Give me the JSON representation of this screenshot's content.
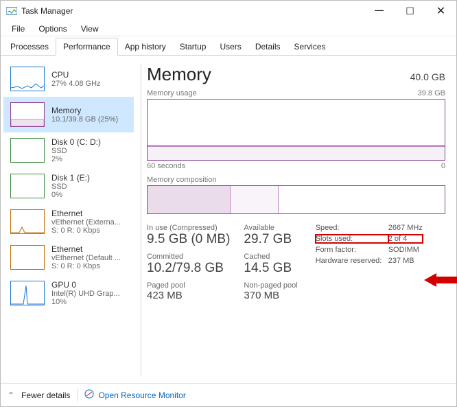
{
  "window": {
    "title": "Task Manager"
  },
  "menu": {
    "file": "File",
    "options": "Options",
    "view": "View"
  },
  "tabs": {
    "processes": "Processes",
    "performance": "Performance",
    "app_history": "App history",
    "startup": "Startup",
    "users": "Users",
    "details": "Details",
    "services": "Services"
  },
  "sidebar": {
    "cpu": {
      "name": "CPU",
      "sub": "27% 4.08 GHz"
    },
    "memory": {
      "name": "Memory",
      "sub": "10.1/39.8 GB (25%)"
    },
    "disk0": {
      "name": "Disk 0 (C: D:)",
      "sub1": "SSD",
      "sub2": "2%"
    },
    "disk1": {
      "name": "Disk 1 (E:)",
      "sub1": "SSD",
      "sub2": "0%"
    },
    "eth0": {
      "name": "Ethernet",
      "sub1": "vEthernet (Externa...",
      "sub2": "S: 0  R: 0 Kbps"
    },
    "eth1": {
      "name": "Ethernet",
      "sub1": "vEthernet (Default ...",
      "sub2": "S: 0  R: 0 Kbps"
    },
    "gpu0": {
      "name": "GPU 0",
      "sub1": "Intel(R) UHD Grap...",
      "sub2": "10%"
    }
  },
  "main": {
    "title": "Memory",
    "capacity": "40.0 GB",
    "usage_label": "Memory usage",
    "usage_max": "39.8 GB",
    "time_left": "60 seconds",
    "time_right": "0",
    "comp_label": "Memory composition",
    "stats": {
      "inuse_lbl": "In use (Compressed)",
      "inuse_val": "9.5 GB (0 MB)",
      "avail_lbl": "Available",
      "avail_val": "29.7 GB",
      "commit_lbl": "Committed",
      "commit_val": "10.2/79.8 GB",
      "cached_lbl": "Cached",
      "cached_val": "14.5 GB",
      "pagedpool_lbl": "Paged pool",
      "pagedpool_val": "423 MB",
      "nonpaged_lbl": "Non-paged pool",
      "nonpaged_val": "370 MB"
    },
    "kv": {
      "speed_lbl": "Speed:",
      "speed_val": "2667 MHz",
      "slots_lbl": "Slots used:",
      "slots_val": "2 of 4",
      "form_lbl": "Form factor:",
      "form_val": "SODIMM",
      "hwres_lbl": "Hardware reserved:",
      "hwres_val": "237 MB"
    }
  },
  "footer": {
    "fewer": "Fewer details",
    "monitor": "Open Resource Monitor"
  }
}
